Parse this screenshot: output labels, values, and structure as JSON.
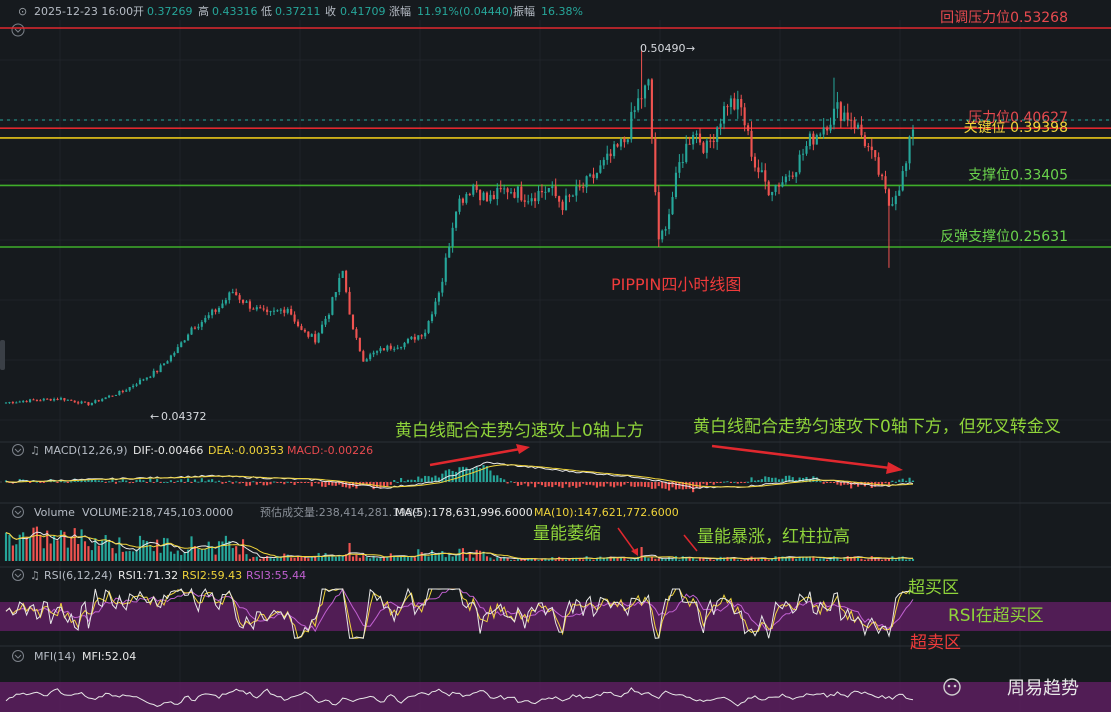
{
  "header": {
    "datetime": "2025-12-23 16:00",
    "open_label": "开",
    "open": "0.37269",
    "high_label": "高",
    "high": "0.43316",
    "low_label": "低",
    "low": "0.37211",
    "close_label": "收",
    "close": "0.41709",
    "change_label": "涨幅",
    "change": "11.91%(0.04440)",
    "amplitude_label": "振幅",
    "amplitude": "16.38%"
  },
  "levels": [
    {
      "label": "回调压力位0.53268",
      "value": 0.53268,
      "color": "#e0282e",
      "text_color": "#e84a4f"
    },
    {
      "label": "压力位0.40627",
      "value": 0.40627,
      "color": "#e0282e",
      "text_color": "#e84a4f"
    },
    {
      "label": "关键位 0.39398",
      "value": 0.39398,
      "color": "#e6c619",
      "text_color": "#f0d43a"
    },
    {
      "label": "支撑位0.33405",
      "value": 0.33405,
      "color": "#3fae2a",
      "text_color": "#6ad34c"
    },
    {
      "label": "反弹支撑位0.25631",
      "value": 0.25631,
      "color": "#3fae2a",
      "text_color": "#6ad34c"
    }
  ],
  "price_marks": {
    "high": "0.50490",
    "low": "0.04372"
  },
  "chart_title": "PIPPIN四小时线图",
  "annotations": {
    "macd_up": "黄白线配合走势匀速攻上0轴上方",
    "macd_down": "黄白线配合走势匀速攻下0轴下方，但死叉转金叉",
    "vol_shrink": "量能萎缩",
    "vol_surge": "量能暴涨，红柱拉高",
    "overbought": "超买区",
    "rsi_note": "RSI在超买区",
    "oversold": "超卖区"
  },
  "macd": {
    "name": "MACD(12,26,9)",
    "dif": "DIF:-0.00466",
    "dea": "DEA:-0.00353",
    "macd": "MACD:-0.00226"
  },
  "volume": {
    "name": "Volume",
    "volume": "VOLUME:218,745,103.0000",
    "est": "预估成交量:238,414,281.1989",
    "ma5": "MA(5):178,631,996.6000",
    "ma10": "MA(10):147,621,772.6000"
  },
  "rsi": {
    "name": "RSI(6,12,24)",
    "rsi1": "RSI1:71.32",
    "rsi2": "RSI2:59.43",
    "rsi3": "RSI3:55.44"
  },
  "mfi": {
    "name": "MFI(14)",
    "mfi": "MFI:52.04"
  },
  "watermark": "周易趋势",
  "colors": {
    "up": "#26a69a",
    "down": "#ef5350",
    "background": "#161a1e",
    "rsi_band": "#5c1f5f",
    "annotation_green": "#8fd43a"
  },
  "chart_data": {
    "type": "candlestick",
    "title": "PIPPIN四小时线图",
    "ylim": [
      0.03,
      0.56
    ],
    "anchors": [
      [
        0,
        0.06
      ],
      [
        8,
        0.063
      ],
      [
        16,
        0.065
      ],
      [
        24,
        0.058
      ],
      [
        30,
        0.068
      ],
      [
        34,
        0.074
      ],
      [
        40,
        0.09
      ],
      [
        44,
        0.1
      ],
      [
        50,
        0.128
      ],
      [
        54,
        0.155
      ],
      [
        58,
        0.165
      ],
      [
        62,
        0.18
      ],
      [
        66,
        0.2
      ],
      [
        70,
        0.185
      ],
      [
        76,
        0.17
      ],
      [
        82,
        0.18
      ],
      [
        86,
        0.15
      ],
      [
        90,
        0.14
      ],
      [
        94,
        0.175
      ],
      [
        98,
        0.225
      ],
      [
        101,
        0.15
      ],
      [
        104,
        0.115
      ],
      [
        110,
        0.128
      ],
      [
        116,
        0.135
      ],
      [
        122,
        0.15
      ],
      [
        127,
        0.215
      ],
      [
        131,
        0.31
      ],
      [
        136,
        0.335
      ],
      [
        140,
        0.315
      ],
      [
        146,
        0.33
      ],
      [
        152,
        0.32
      ],
      [
        158,
        0.33
      ],
      [
        162,
        0.31
      ],
      [
        170,
        0.34
      ],
      [
        176,
        0.37
      ],
      [
        180,
        0.39
      ],
      [
        184,
        0.44
      ],
      [
        187,
        0.46
      ],
      [
        190,
        0.26
      ],
      [
        193,
        0.3
      ],
      [
        196,
        0.36
      ],
      [
        200,
        0.405
      ],
      [
        204,
        0.38
      ],
      [
        210,
        0.44
      ],
      [
        214,
        0.43
      ],
      [
        218,
        0.36
      ],
      [
        222,
        0.33
      ],
      [
        226,
        0.34
      ],
      [
        230,
        0.36
      ],
      [
        234,
        0.39
      ],
      [
        238,
        0.41
      ],
      [
        242,
        0.43
      ],
      [
        246,
        0.42
      ],
      [
        250,
        0.39
      ],
      [
        254,
        0.35
      ],
      [
        257,
        0.31
      ],
      [
        260,
        0.335
      ],
      [
        262,
        0.36
      ],
      [
        264,
        0.41
      ]
    ],
    "spikes": [
      [
        185,
        0.5049
      ],
      [
        190,
        0.2563
      ],
      [
        217,
        0.415
      ],
      [
        241,
        0.47
      ],
      [
        257,
        0.23
      ]
    ],
    "macd_points": [
      [
        0,
        0
      ],
      [
        60,
        0.004
      ],
      [
        90,
        0.0015
      ],
      [
        110,
        -0.004
      ],
      [
        125,
        0
      ],
      [
        140,
        0.013
      ],
      [
        160,
        0.008
      ],
      [
        185,
        0.003
      ],
      [
        200,
        -0.004
      ],
      [
        215,
        -0.003
      ],
      [
        235,
        0.002
      ],
      [
        255,
        -0.003
      ],
      [
        264,
        -0.0005
      ]
    ]
  }
}
